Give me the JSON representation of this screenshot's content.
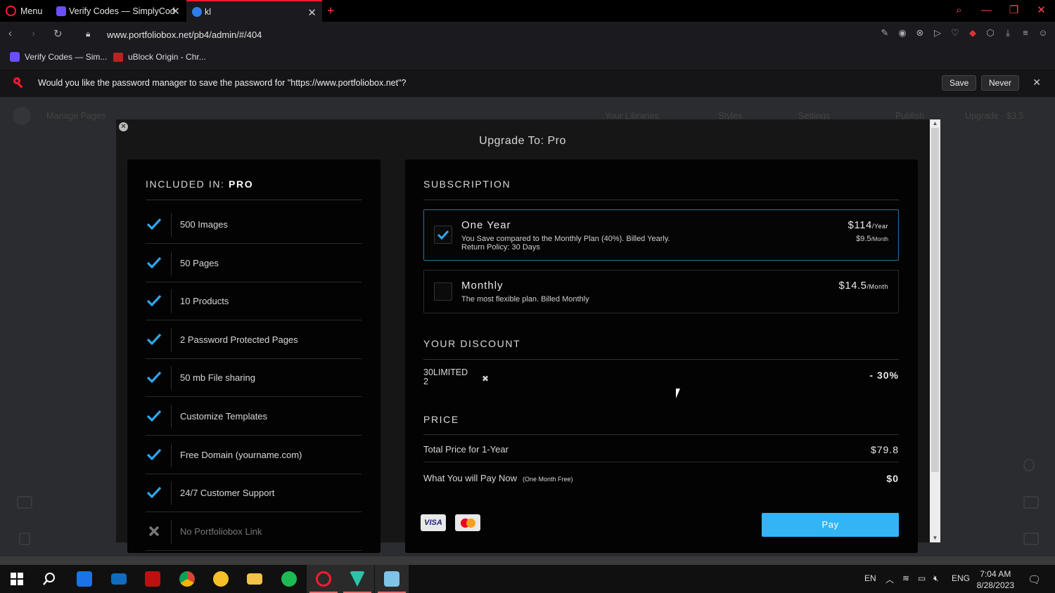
{
  "browser": {
    "menu_label": "Menu",
    "tabs": [
      {
        "title": "Verify Codes — SimplyCod"
      },
      {
        "title": "kl"
      }
    ],
    "url": "www.portfoliobox.net/pb4/admin/#/404",
    "bookmarks": [
      {
        "label": "Verify Codes — Sim..."
      },
      {
        "label": "uBlock Origin - Chr..."
      }
    ],
    "password_prompt": {
      "text": "Would you like the password manager to save the password for \"https://www.portfoliobox.net\"?",
      "save_label": "Save",
      "never_label": "Never"
    },
    "accent_color": "#ff1b2d"
  },
  "background_page": {
    "manage_pages": "Manage Pages",
    "your_libraries": "Your Libraries",
    "styles": "Styles",
    "settings": "Settings",
    "publish": "Publish",
    "upgrade": "Upgrade · $3.5"
  },
  "modal": {
    "title": "Upgrade To: Pro",
    "included": {
      "heading_prefix": "INCLUDED IN: ",
      "heading_plan": "PRO",
      "features": [
        {
          "label": "500 Images",
          "included": true
        },
        {
          "label": "50 Pages",
          "included": true
        },
        {
          "label": "10 Products",
          "included": true
        },
        {
          "label": "2 Password Protected Pages",
          "included": true
        },
        {
          "label": "50 mb File sharing",
          "included": true
        },
        {
          "label": "Customize Templates",
          "included": true
        },
        {
          "label": "Free Domain (yourname.com)",
          "included": true
        },
        {
          "label": "24/7 Customer Support",
          "included": true
        },
        {
          "label": "No Portfoliobox Link",
          "included": false
        }
      ]
    },
    "subscription": {
      "heading": "SUBSCRIPTION",
      "plans": [
        {
          "name": "One Year",
          "desc1": "You Save compared to the Monthly Plan (40%). Billed Yearly.",
          "desc2": "Return Policy: 30 Days",
          "price": "$114",
          "price_unit": "/Year",
          "sub_price": "$9.5",
          "sub_unit": "/Month",
          "selected": true
        },
        {
          "name": "Monthly",
          "desc1": "The most flexible plan. Billed Monthly",
          "price": "$14.5",
          "price_unit": "/Month",
          "selected": false
        }
      ]
    },
    "discount": {
      "heading": "YOUR DISCOUNT",
      "code_line1": "30LIMITED",
      "code_line2": "2",
      "value": "- 30%"
    },
    "price": {
      "heading": "PRICE",
      "total_label": "Total Price for 1-Year",
      "total_value": "$79.8",
      "now_label": "What You will Pay Now",
      "now_note": "(One Month Free)",
      "now_value": "$0"
    },
    "cards": {
      "visa": "VISA"
    },
    "pay_label": "Pay",
    "pay_color": "#33b5f5",
    "check_color": "#2ea8f0"
  },
  "taskbar": {
    "lang_en": "EN",
    "lang_eng": "ENG",
    "time": "7:04 AM",
    "date": "8/28/2023"
  }
}
